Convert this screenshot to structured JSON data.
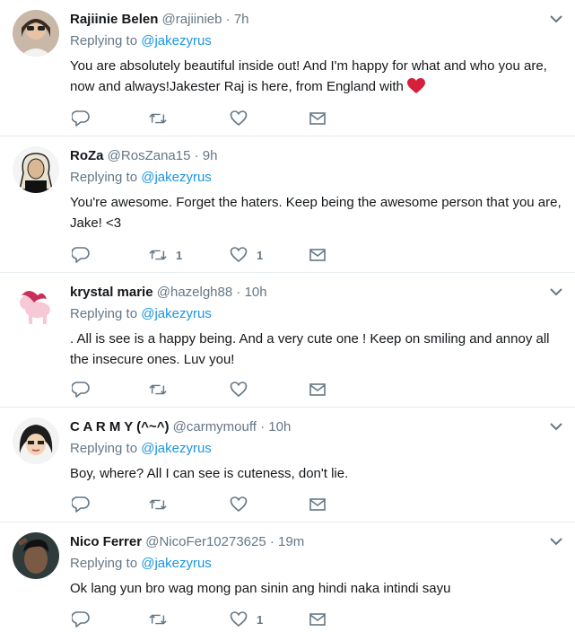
{
  "colors": {
    "name": "#14171a",
    "meta": "#657786",
    "mention": "#1b95e0",
    "divider": "#e6ecf0",
    "heart": "#e0245e"
  },
  "icons": {
    "reply": "reply-icon",
    "retweet": "retweet-icon",
    "like": "heart-icon",
    "dm": "envelope-icon",
    "menu": "chevron-down-icon"
  },
  "replies": [
    {
      "name": "Rajiinie Belen",
      "handle": "@rajiinieb",
      "dot": "·",
      "time": "7h",
      "replying_label": "Replying to",
      "replying_to": "@jakezyrus",
      "text": "You are absolutely beautiful inside out! And I'm happy for what and who you are, now and always!Jakester Raj is here, from England with",
      "emoji": "red-heart",
      "retweets": "",
      "likes": ""
    },
    {
      "name": "RoZa",
      "handle": "@RosZana15",
      "dot": "·",
      "time": "9h",
      "replying_label": "Replying to",
      "replying_to": "@jakezyrus",
      "text": "You're awesome. Forget the haters. Keep being the awesome person that you are, Jake! <3",
      "retweets": "1",
      "likes": "1"
    },
    {
      "name": "krystal marie",
      "handle": "@hazelgh88",
      "dot": "·",
      "time": "10h",
      "replying_label": "Replying to",
      "replying_to": "@jakezyrus",
      "text": ". All is see is a happy being. And a very cute one !  Keep on smiling and annoy all the insecure ones. Luv you!",
      "retweets": "",
      "likes": ""
    },
    {
      "name": "C A R M Y (^~^)",
      "handle": "@carmymouff",
      "dot": "·",
      "time": "10h",
      "replying_label": "Replying to",
      "replying_to": "@jakezyrus",
      "text": "Boy, where? All I can see is cuteness, don't lie.",
      "retweets": "",
      "likes": ""
    },
    {
      "name": "Nico Ferrer",
      "handle": "@NicoFer10273625",
      "dot": "·",
      "time": "19m",
      "replying_label": "Replying to",
      "replying_to": "@jakezyrus",
      "text": "Ok lang yun bro wag mong pan sinin ang hindi naka intindi sayu",
      "retweets": "",
      "likes": "1"
    }
  ]
}
